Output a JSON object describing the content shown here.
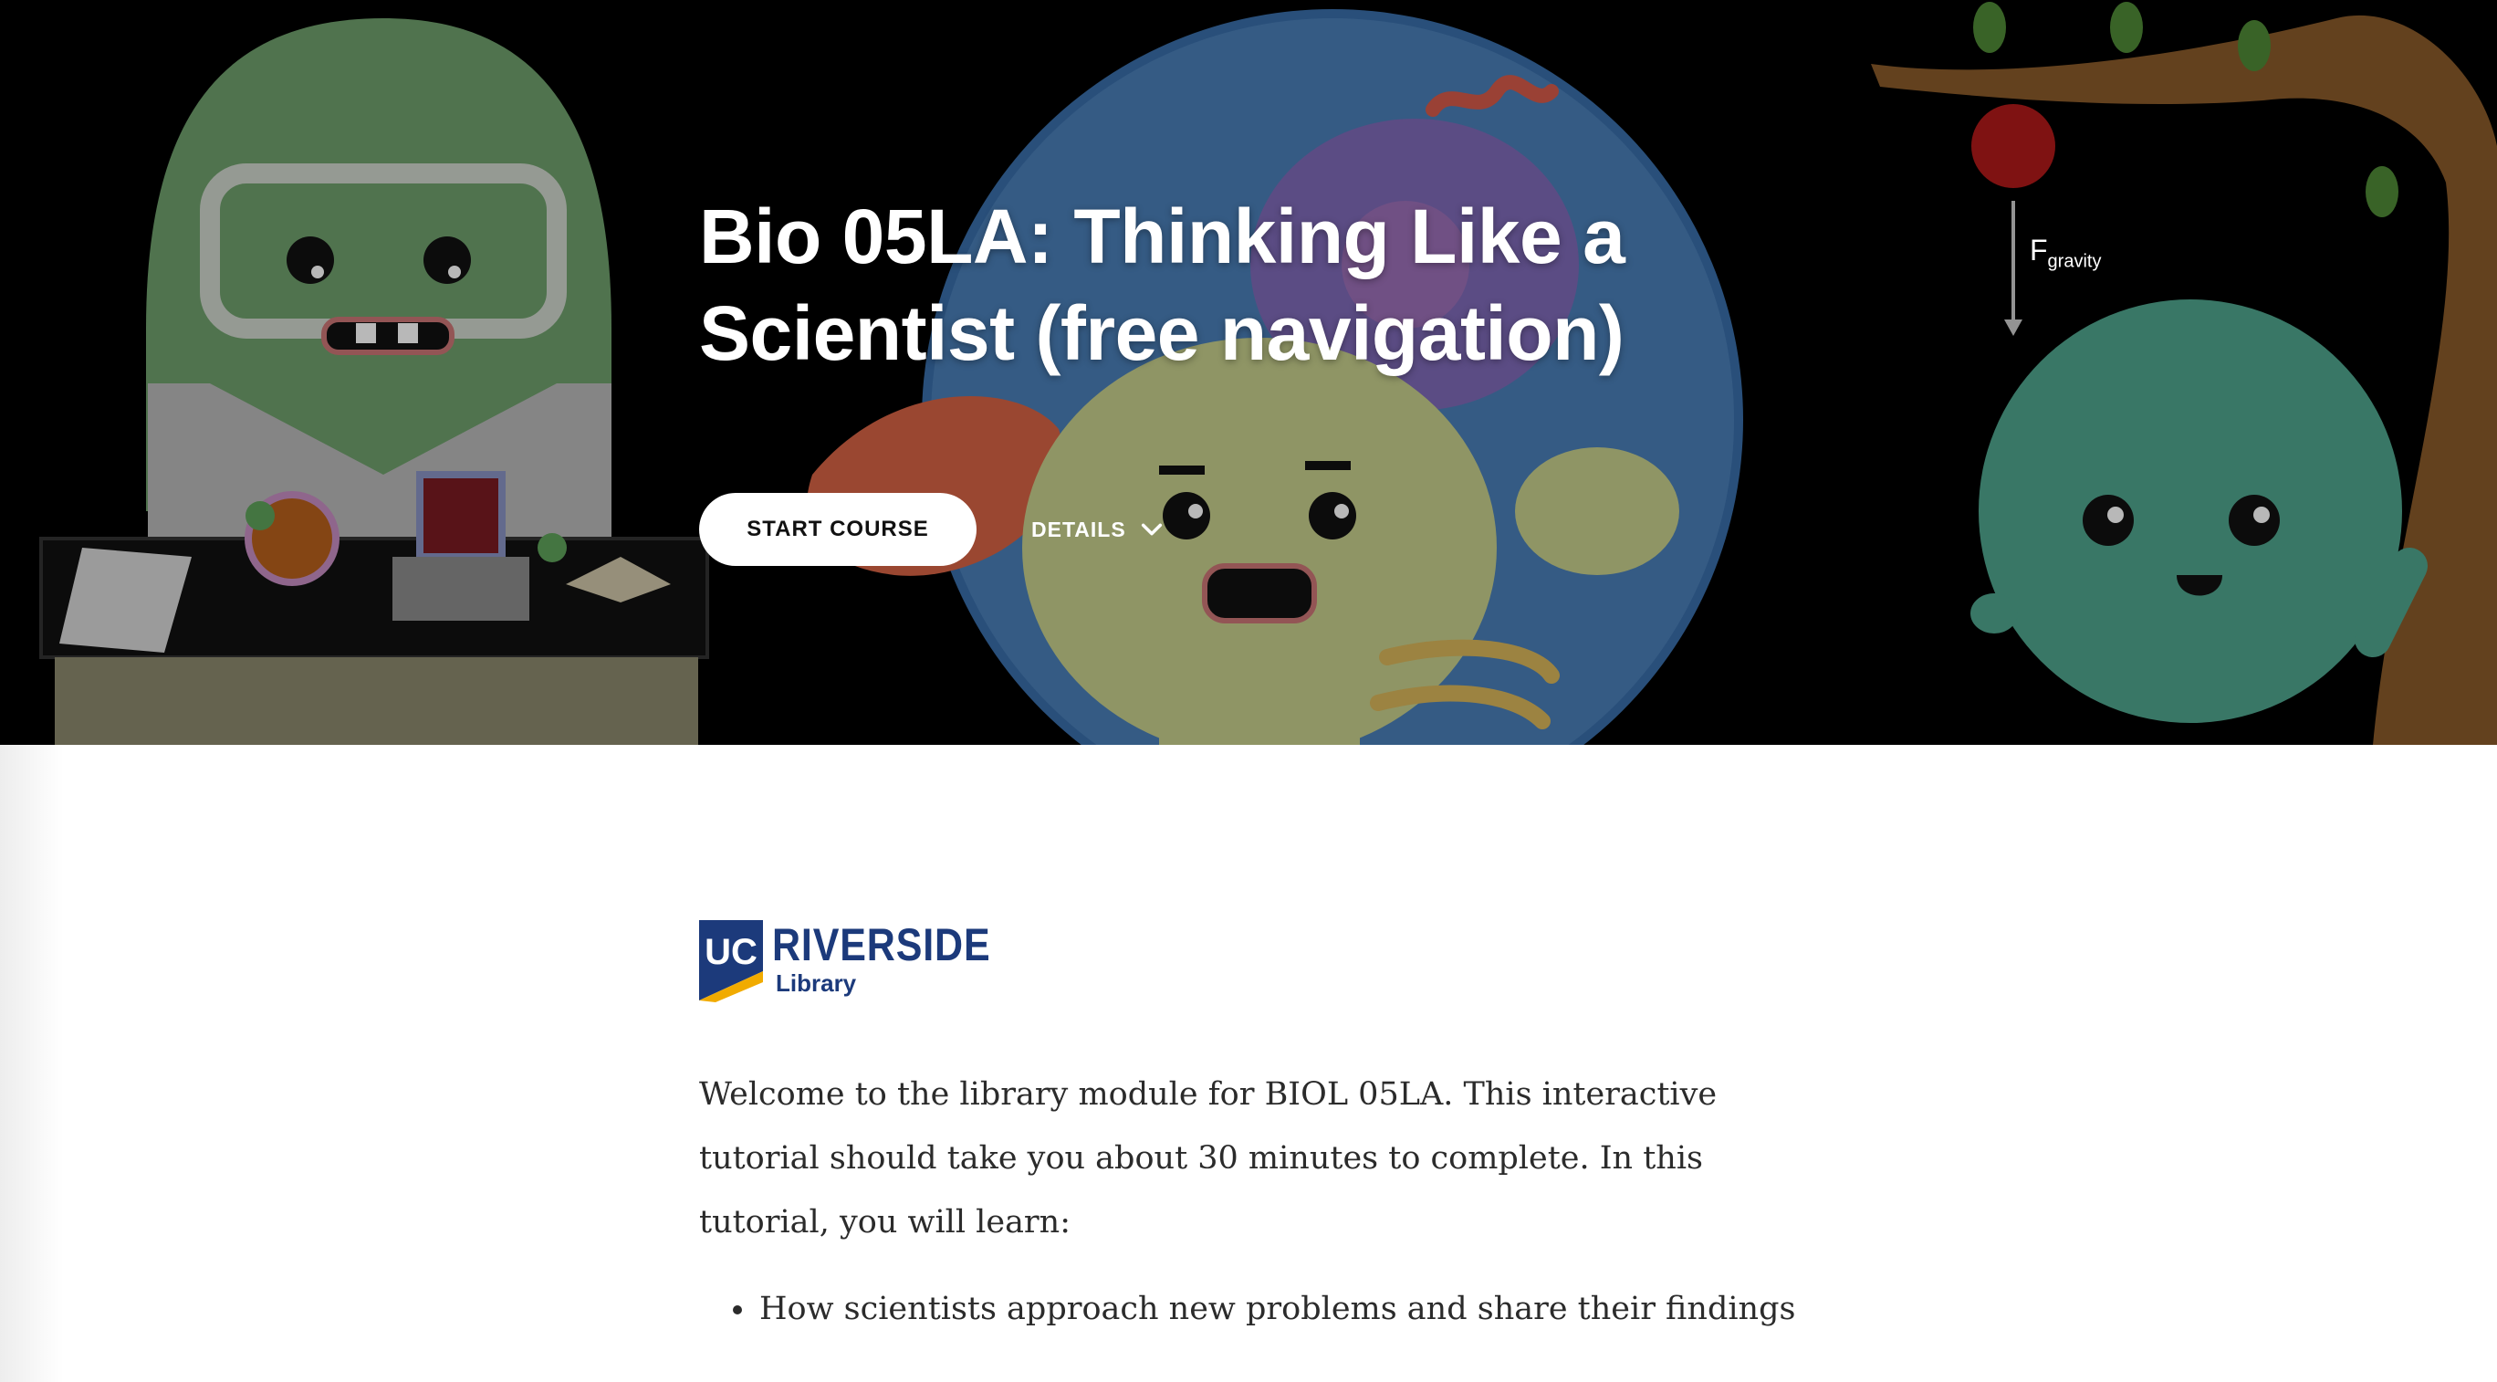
{
  "hero": {
    "title": "Bio 05LA: Thinking Like a Scientist (free navigation)",
    "start_label": "START COURSE",
    "details_label": "DETAILS",
    "details_icon": "chevron-down-icon",
    "force_label": "F",
    "force_subscript": "gravity"
  },
  "logo": {
    "mark_text": "UC",
    "name": "RIVERSIDE",
    "sub": "Library",
    "brand_color": "#1c3a7b",
    "accent_color": "#f1ab00"
  },
  "content": {
    "intro": "Welcome to the library module for BIOL 05LA. This interactive tutorial should take you about 30 minutes to complete. In this tutorial, you will learn:",
    "bullets": [
      "How scientists approach new problems and share their findings"
    ]
  }
}
